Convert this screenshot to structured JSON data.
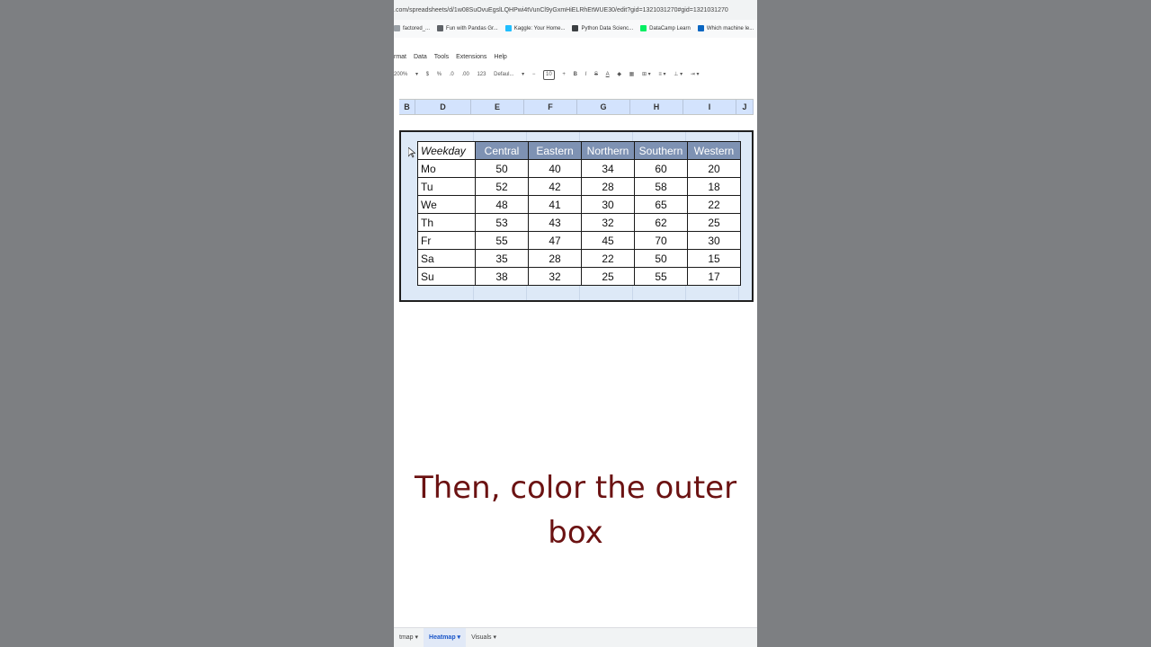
{
  "browser": {
    "url": ".com/spreadsheets/d/1w08SuOvuEgslLQHPwi4tVunCl9yGxmHiELRhEtWUE30/edit?gid=1321031270#gid=1321031270",
    "bookmarks": [
      {
        "label": "factored_...",
        "color": "#9aa0a6"
      },
      {
        "label": "Fun with Pandas Gr...",
        "color": "#5f6368"
      },
      {
        "label": "Kaggle: Your Home...",
        "color": "#20beff"
      },
      {
        "label": "Python Data Scienc...",
        "color": "#3c4043"
      },
      {
        "label": "DataCamp Learn",
        "color": "#03ef62"
      },
      {
        "label": "Which machine le...",
        "color": "#0a66c2"
      }
    ]
  },
  "menu": [
    "rmat",
    "Data",
    "Tools",
    "Extensions",
    "Help"
  ],
  "toolbar": {
    "zoom": "200%",
    "currency": "$",
    "percent": "%",
    "decrease_decimal": ".0",
    "increase_decimal": ".00",
    "number_format": "123",
    "font": "Defaul...",
    "font_size": "10",
    "bold": "B",
    "italic": "I",
    "strikethrough": "S",
    "text_color": "A"
  },
  "columns": [
    "B",
    "D",
    "E",
    "F",
    "G",
    "H",
    "I",
    "J"
  ],
  "table": {
    "headers": [
      "Weekday",
      "Central",
      "Eastern",
      "Northern",
      "Southern",
      "Western"
    ],
    "rows": [
      [
        "Mo",
        "50",
        "40",
        "34",
        "60",
        "20"
      ],
      [
        "Tu",
        "52",
        "42",
        "28",
        "58",
        "18"
      ],
      [
        "We",
        "48",
        "41",
        "30",
        "65",
        "22"
      ],
      [
        "Th",
        "53",
        "43",
        "32",
        "62",
        "25"
      ],
      [
        "Fr",
        "55",
        "47",
        "45",
        "70",
        "30"
      ],
      [
        "Sa",
        "35",
        "28",
        "22",
        "50",
        "15"
      ],
      [
        "Su",
        "38",
        "32",
        "25",
        "55",
        "17"
      ]
    ]
  },
  "caption": "Then, color the outer box",
  "sheet_tabs": [
    {
      "label": "tmap ▾",
      "active": false
    },
    {
      "label": "Heatmap ▾",
      "active": true
    },
    {
      "label": "Visuals ▾",
      "active": false
    }
  ],
  "colors": {
    "header_fill": "#7e92b3",
    "outer_box_fill": "#dde9f7",
    "caption": "#6b1212"
  }
}
